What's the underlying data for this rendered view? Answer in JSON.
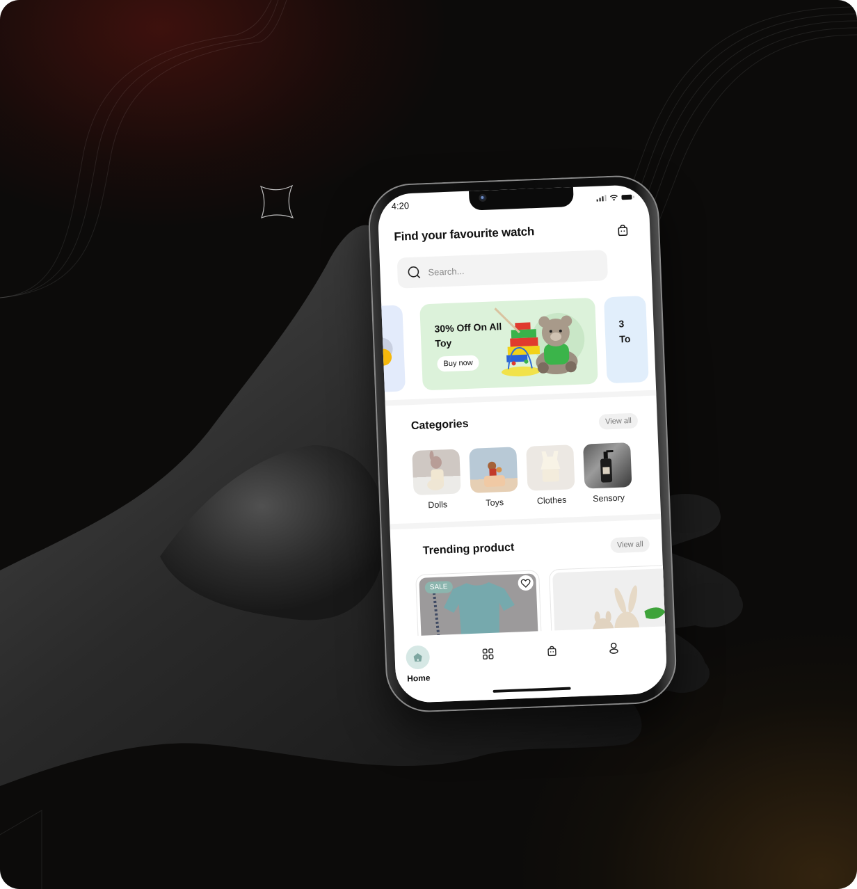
{
  "status_bar": {
    "time": "4:20"
  },
  "header": {
    "title": "Find your favourite watch",
    "cart_icon": "shopping-bag-icon"
  },
  "search": {
    "placeholder": "Search...",
    "value": "",
    "icon": "search-icon"
  },
  "banners": {
    "main": {
      "text": "30% Off On All Toy",
      "button": "Buy now",
      "bg": "#dcf2da"
    },
    "next": {
      "text_partial_line1": "3",
      "text_partial_line2": "To",
      "bg": "#e1eefb"
    },
    "prev": {
      "bg": "#e3ebfb"
    }
  },
  "categories": {
    "title": "Categories",
    "view_all": "View all",
    "items": [
      {
        "label": "Dolls"
      },
      {
        "label": "Toys"
      },
      {
        "label": "Clothes"
      },
      {
        "label": "Sensory"
      }
    ]
  },
  "trending": {
    "title": "Trending product",
    "view_all": "View all",
    "products": [
      {
        "badge": "SALE",
        "favorite_icon": "heart-icon"
      },
      {}
    ]
  },
  "tabbar": {
    "items": [
      {
        "label": "Home",
        "icon": "home-icon",
        "active": true
      },
      {
        "icon": "grid-icon"
      },
      {
        "icon": "shopping-bag-icon"
      },
      {
        "icon": "profile-icon"
      }
    ]
  },
  "colors": {
    "accent": "#8bb5ae",
    "home_tab_bg": "#d6e8e5",
    "background": "#0c0b0a"
  }
}
